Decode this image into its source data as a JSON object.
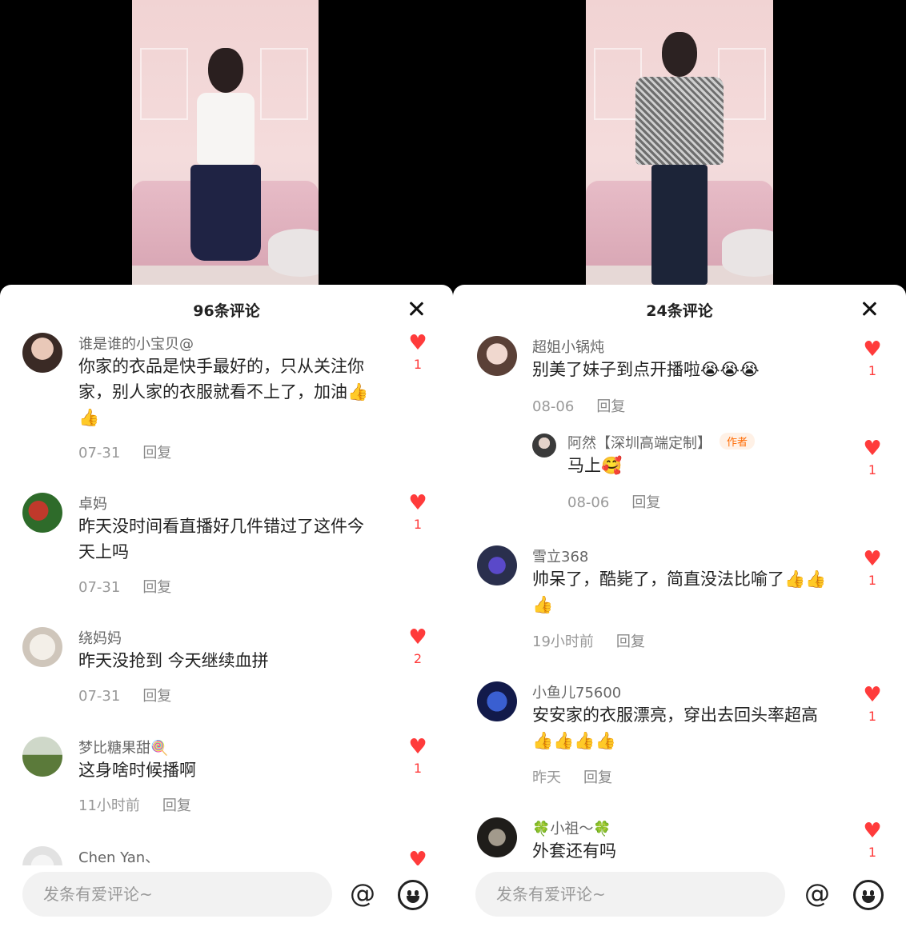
{
  "left": {
    "title": "96条评论",
    "input_placeholder": "发条有爱评论~",
    "comments": [
      {
        "name": "谁是谁的小宝贝@",
        "text": "你家的衣品是快手最好的，只从关注你家，别人家的衣服就看不上了，加油👍👍",
        "date": "07-31",
        "reply": "回复",
        "likes": "1"
      },
      {
        "name": "卓妈",
        "text": "昨天没时间看直播好几件错过了这件今天上吗",
        "date": "07-31",
        "reply": "回复",
        "likes": "1"
      },
      {
        "name": "绕妈妈",
        "text": "昨天没抢到 今天继续血拼",
        "date": "07-31",
        "reply": "回复",
        "likes": "2"
      },
      {
        "name": "梦比糖果甜🍭",
        "text": "这身啥时候播啊",
        "date": "11小时前",
        "reply": "回复",
        "likes": "1"
      },
      {
        "name": "Chen Yan、",
        "text": "",
        "date": "",
        "reply": "",
        "likes": ""
      }
    ]
  },
  "right": {
    "title": "24条评论",
    "input_placeholder": "发条有爱评论~",
    "comments": [
      {
        "name": "超姐小锅炖",
        "text": "别美了妹子到点开播啦😭😭😭",
        "date": "08-06",
        "reply": "回复",
        "likes": "1"
      },
      {
        "name": "阿然【深圳高端定制】",
        "badge": "作者",
        "text": "马上🥰",
        "date": "08-06",
        "reply": "回复",
        "likes": "1"
      },
      {
        "name": "雪立368",
        "text": "帅呆了，酷毙了，简直没法比喻了👍👍👍",
        "date": "19小时前",
        "reply": "回复",
        "likes": "1"
      },
      {
        "name": "小鱼儿75600",
        "text": "安安家的衣服漂亮，穿出去回头率超高👍👍👍👍",
        "date": "昨天",
        "reply": "回复",
        "likes": "1"
      },
      {
        "name": "🍀小祖～🍀",
        "text": "外套还有吗",
        "date": "",
        "reply": "",
        "likes": "1"
      }
    ]
  },
  "icons": {
    "like": "heart-icon",
    "close": "close-icon",
    "mention": "at-icon",
    "emoji": "smiley-icon"
  },
  "colors": {
    "heart": "#ff3b3b",
    "badge": "#ff6a00"
  }
}
